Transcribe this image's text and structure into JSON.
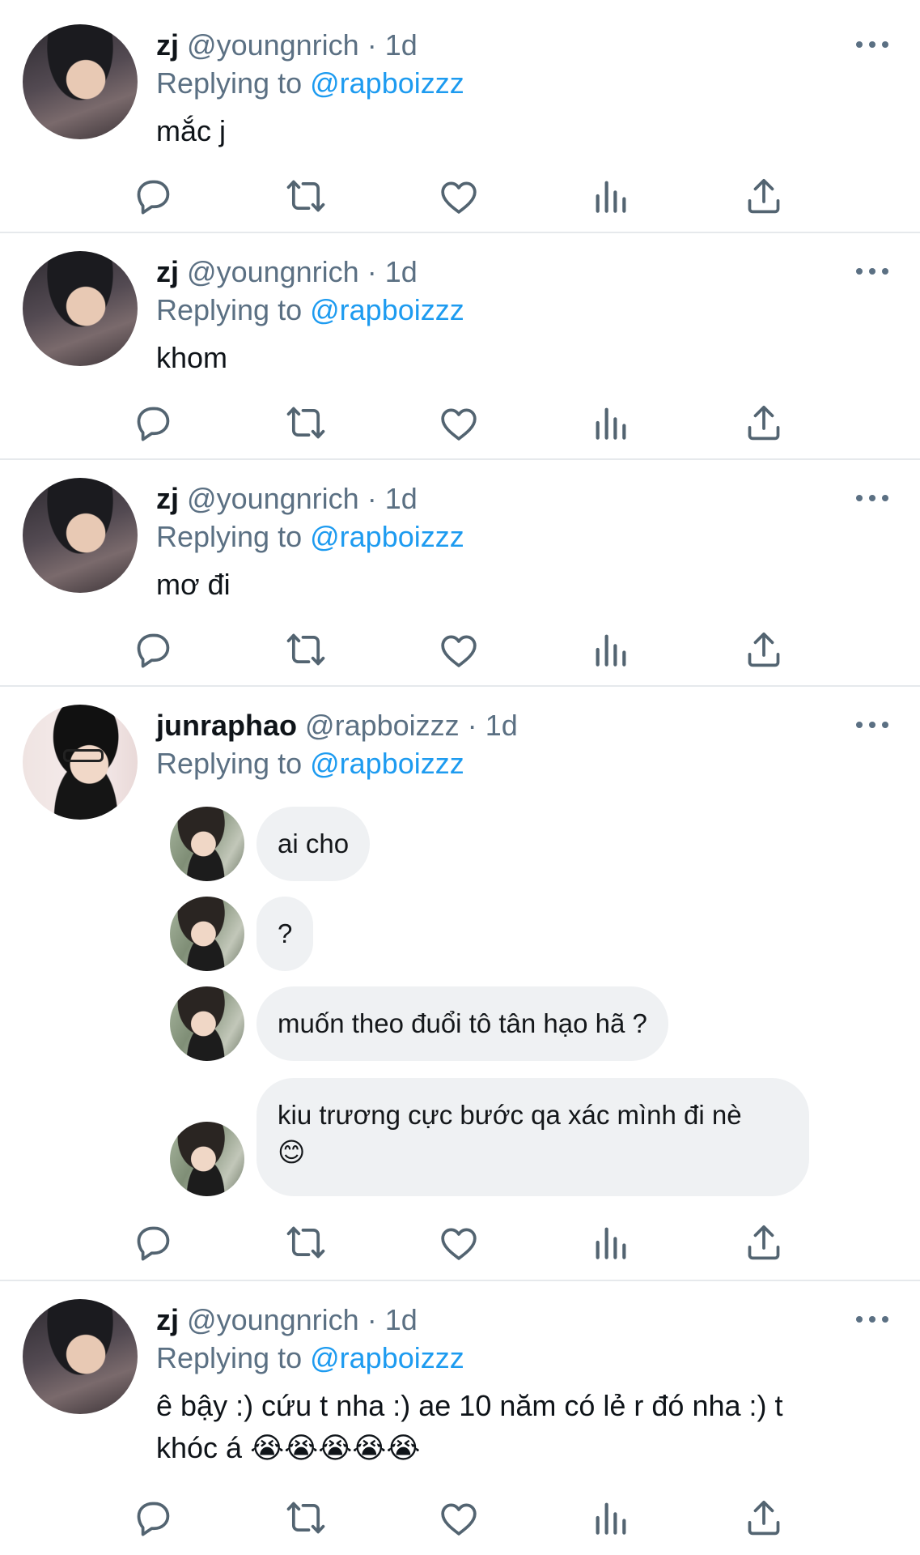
{
  "tweets": [
    {
      "name": "zj",
      "handle": "@youngnrich",
      "dot": "·",
      "time": "1d",
      "replying_prefix": "Replying to",
      "replying_handle": "@rapboizzz",
      "text": "mắc j"
    },
    {
      "name": "zj",
      "handle": "@youngnrich",
      "dot": "·",
      "time": "1d",
      "replying_prefix": "Replying to",
      "replying_handle": "@rapboizzz",
      "text": "khom"
    },
    {
      "name": "zj",
      "handle": "@youngnrich",
      "dot": "·",
      "time": "1d",
      "replying_prefix": "Replying to",
      "replying_handle": "@rapboizzz",
      "text": "mơ đi"
    },
    {
      "name": "junraphao",
      "handle": "@rapboizzz",
      "dot": "·",
      "time": "1d",
      "replying_prefix": "Replying to",
      "replying_handle": "@rapboizzz",
      "messages": [
        "ai cho",
        "?",
        "muốn theo đuổi tô tân hạo hã ?",
        "kiu trương cực bước qa xác mình đi nè\n😊"
      ]
    },
    {
      "name": "zj",
      "handle": "@youngnrich",
      "dot": "·",
      "time": "1d",
      "replying_prefix": "Replying to",
      "replying_handle": "@rapboizzz",
      "text": "ê bậy :) cứu t nha :) ae 10 năm có lẻ r đó nha :) t khóc á 😭😭😭😭😭"
    }
  ],
  "icons": {
    "reply": "reply-icon",
    "retweet": "retweet-icon",
    "like": "heart-icon",
    "views": "analytics-icon",
    "share": "share-icon",
    "more": "more-icon"
  },
  "colors": {
    "link": "#1d9bf0",
    "secondary_text": "#5b7083",
    "icon": "#536471",
    "bubble": "#eff1f3",
    "divider": "#e6e9ec"
  }
}
